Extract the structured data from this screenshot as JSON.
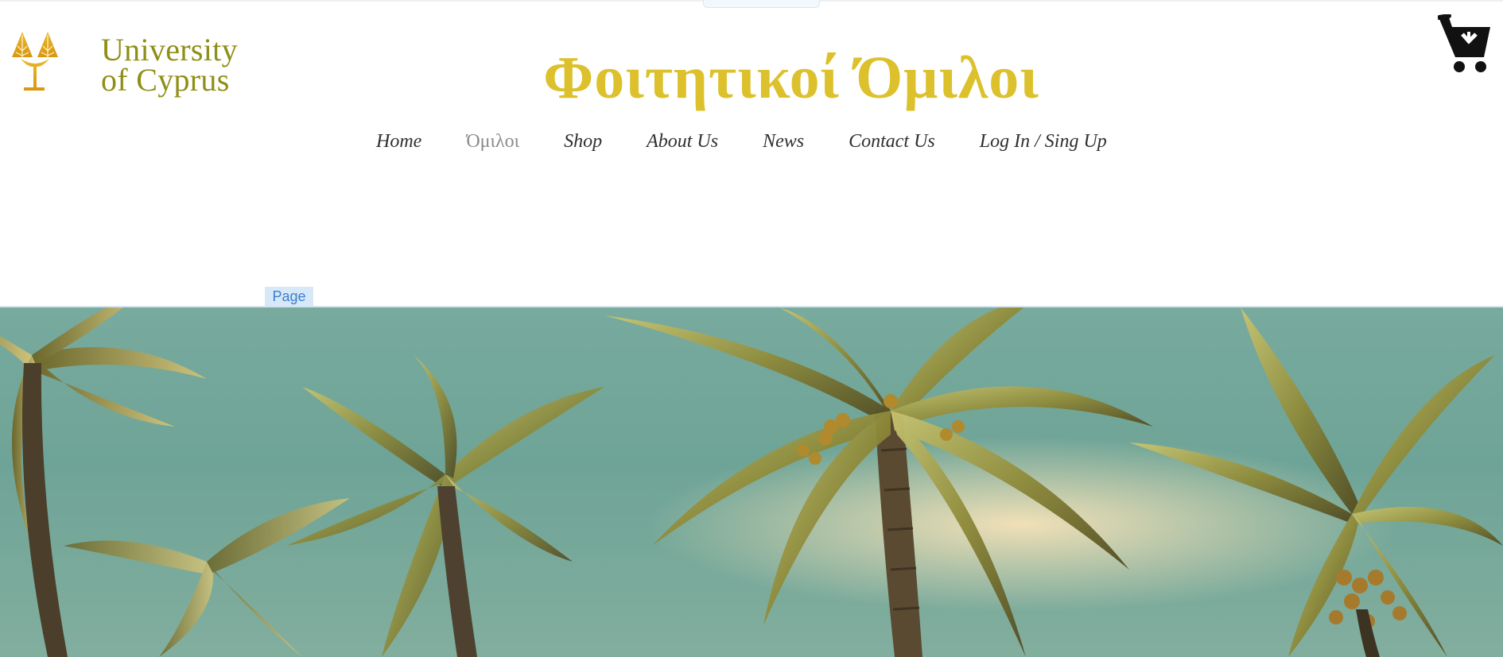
{
  "header": {
    "logo": {
      "line1": "University",
      "line2": "of Cyprus"
    },
    "title": "Φοιτητικοί Όμιλοι",
    "cart_icon": "shopping-cart-icon"
  },
  "nav": {
    "items": [
      {
        "label": "Home",
        "active": false
      },
      {
        "label": "Όμιλοι",
        "active": true
      },
      {
        "label": "Shop",
        "active": false
      },
      {
        "label": "About Us",
        "active": false
      },
      {
        "label": "News",
        "active": false
      },
      {
        "label": "Contact Us",
        "active": false
      },
      {
        "label": "Log In / Sing Up",
        "active": false
      }
    ]
  },
  "editor": {
    "page_label": "Page"
  },
  "colors": {
    "title": "#dcc12c",
    "logo": "#8f8e16",
    "nav_text": "#2f2f2f",
    "nav_active": "#8b8b8b",
    "page_label_bg": "#d7e8f9",
    "page_label_text": "#3c7fd0"
  },
  "hero": {
    "description_icon": "palm-trees-image"
  }
}
